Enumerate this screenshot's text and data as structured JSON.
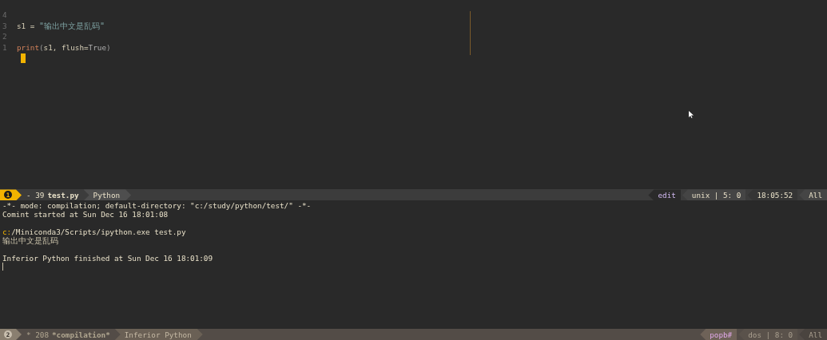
{
  "editor": {
    "lines": [
      {
        "number": "4"
      },
      {
        "number": "3",
        "tokens": [
          {
            "kind": "variable",
            "text": "s1"
          },
          {
            "kind": "operator",
            "text": " = "
          },
          {
            "kind": "string",
            "text": "\"输出中文是乱码\""
          }
        ]
      },
      {
        "number": "2"
      },
      {
        "number": "1",
        "tokens": [
          {
            "kind": "builtin",
            "text": "print"
          },
          {
            "kind": "punct",
            "text": "("
          },
          {
            "kind": "variable",
            "text": "s1, flush"
          },
          {
            "kind": "operator",
            "text": "="
          },
          {
            "kind": "constant",
            "text": "True"
          },
          {
            "kind": "punct",
            "text": ")"
          }
        ]
      }
    ]
  },
  "mode_lines": [
    {
      "active": true,
      "window_number": "1",
      "buffer_state": "- 39",
      "buffer_name": "test.py",
      "major_mode": "Python",
      "right": [
        {
          "kind": "state",
          "text": "edit"
        },
        {
          "kind": "plain",
          "text": "unix | 5: 0"
        },
        {
          "kind": "plain",
          "text": "18:05:52"
        },
        {
          "kind": "plain",
          "text": "All"
        }
      ]
    },
    {
      "active": false,
      "window_number": "2",
      "buffer_state": "* 208",
      "buffer_name": "*compilation*",
      "major_mode": "Inferior Python",
      "right": [
        {
          "kind": "state",
          "text": "popb#"
        },
        {
          "kind": "plain",
          "text": "dos | 8: 0"
        },
        {
          "kind": "plain",
          "text": "All"
        }
      ]
    }
  ],
  "compilation": {
    "lines": [
      {
        "kind": "plain",
        "segments": [
          {
            "kind": "plain",
            "text": "-*- mode: compilation; default-directory: \"c:/study/python/test/\" -*-"
          }
        ]
      },
      {
        "kind": "plain",
        "segments": [
          {
            "kind": "plain",
            "text": "Comint started at Sun Dec 16 18:01:08"
          }
        ]
      },
      {
        "kind": "blank"
      },
      {
        "kind": "plain",
        "segments": [
          {
            "kind": "drive",
            "text": "c:"
          },
          {
            "kind": "plain",
            "text": "/Miniconda3/Scripts/ipython.exe test.py"
          }
        ]
      },
      {
        "kind": "output",
        "segments": [
          {
            "kind": "plain",
            "text": "输出中文是乱码"
          }
        ]
      },
      {
        "kind": "blank"
      },
      {
        "kind": "plain",
        "segments": [
          {
            "kind": "plain",
            "text": "Inferior Python finished at Sun Dec 16 18:01:09"
          }
        ]
      }
    ]
  }
}
